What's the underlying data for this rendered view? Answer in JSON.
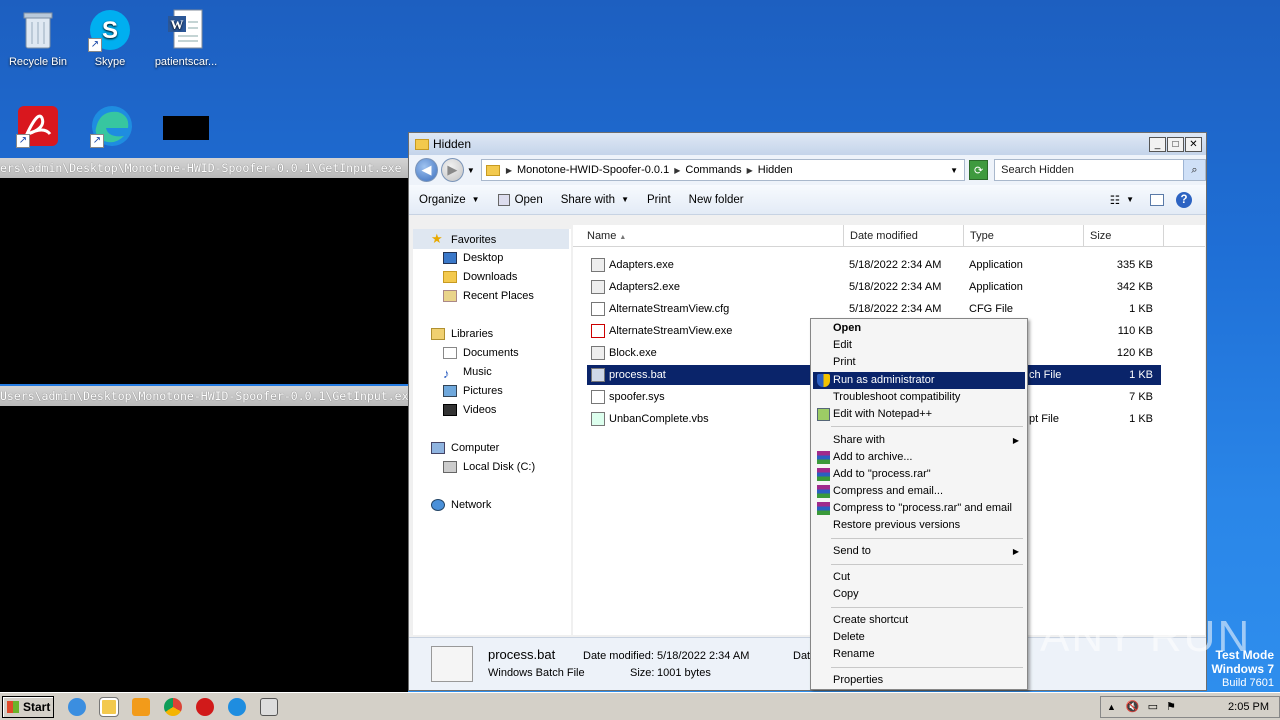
{
  "desktop": {
    "icons": [
      {
        "label": "Recycle Bin",
        "icon": "recycle-bin-icon"
      },
      {
        "label": "Skype",
        "icon": "skype-icon"
      },
      {
        "label": "patientscar...",
        "icon": "word-document-icon"
      },
      {
        "label": "",
        "icon": "acrobat-icon"
      },
      {
        "label": "",
        "icon": "edge-icon"
      },
      {
        "label": "",
        "icon": "blank-black-icon"
      }
    ]
  },
  "consoles": [
    {
      "title": "ers\\admin\\Desktop\\Monotone-HWID-Spoofer-0.0.1\\GetInput.exe"
    },
    {
      "title": "Users\\admin\\Desktop\\Monotone-HWID-Spoofer-0.0.1\\GetInput.exe"
    }
  ],
  "explorer": {
    "title": "Hidden",
    "breadcrumb": [
      "Monotone-HWID-Spoofer-0.0.1",
      "Commands",
      "Hidden"
    ],
    "search_placeholder": "Search Hidden",
    "toolbar": {
      "organize": "Organize",
      "open": "Open",
      "share_with": "Share with",
      "print": "Print",
      "new_folder": "New folder"
    },
    "nav": {
      "favorites": "Favorites",
      "desktop": "Desktop",
      "downloads": "Downloads",
      "recent_places": "Recent Places",
      "libraries": "Libraries",
      "documents": "Documents",
      "music": "Music",
      "pictures": "Pictures",
      "videos": "Videos",
      "computer": "Computer",
      "local_disk": "Local Disk (C:)",
      "network": "Network"
    },
    "columns": {
      "name": "Name",
      "date": "Date modified",
      "type": "Type",
      "size": "Size"
    },
    "files": [
      {
        "name": "Adapters.exe",
        "date": "5/18/2022 2:34 AM",
        "type": "Application",
        "size": "335 KB"
      },
      {
        "name": "Adapters2.exe",
        "date": "5/18/2022 2:34 AM",
        "type": "Application",
        "size": "342 KB"
      },
      {
        "name": "AlternateStreamView.cfg",
        "date": "5/18/2022 2:34 AM",
        "type": "CFG File",
        "size": "1 KB"
      },
      {
        "name": "AlternateStreamView.exe",
        "date": "",
        "type": "",
        "size": "110 KB"
      },
      {
        "name": "Block.exe",
        "date": "",
        "type": "",
        "size": "120 KB"
      },
      {
        "name": "process.bat",
        "date": "",
        "type": "ch File",
        "size": "1 KB"
      },
      {
        "name": "spoofer.sys",
        "date": "",
        "type": "",
        "size": "7 KB"
      },
      {
        "name": "UnbanComplete.vbs",
        "date": "",
        "type": "pt File",
        "size": "1 KB"
      }
    ],
    "details": {
      "name": "process.bat",
      "file_type": "Windows Batch File",
      "date_label": "Date modified:",
      "date_value": "5/18/2022 2:34 AM",
      "size_label": "Size:",
      "size_value": "1001 bytes",
      "extra": "Dat"
    }
  },
  "context_menu": {
    "open": "Open",
    "edit": "Edit",
    "print": "Print",
    "run_as_admin": "Run as administrator",
    "troubleshoot": "Troubleshoot compatibility",
    "notepad": "Edit with Notepad++",
    "share_with": "Share with",
    "add_archive": "Add to archive...",
    "add_rar": "Add to \"process.rar\"",
    "compress_email": "Compress and email...",
    "compress_rar_email": "Compress to \"process.rar\" and email",
    "restore": "Restore previous versions",
    "send_to": "Send to",
    "cut": "Cut",
    "copy": "Copy",
    "create_shortcut": "Create shortcut",
    "delete": "Delete",
    "rename": "Rename",
    "properties": "Properties"
  },
  "watermark": "ANY RUN",
  "testmode": {
    "line1": "Test Mode",
    "line2": "Windows 7",
    "line3": "Build 7601"
  },
  "taskbar": {
    "start": "Start",
    "clock": "2:05 PM"
  }
}
